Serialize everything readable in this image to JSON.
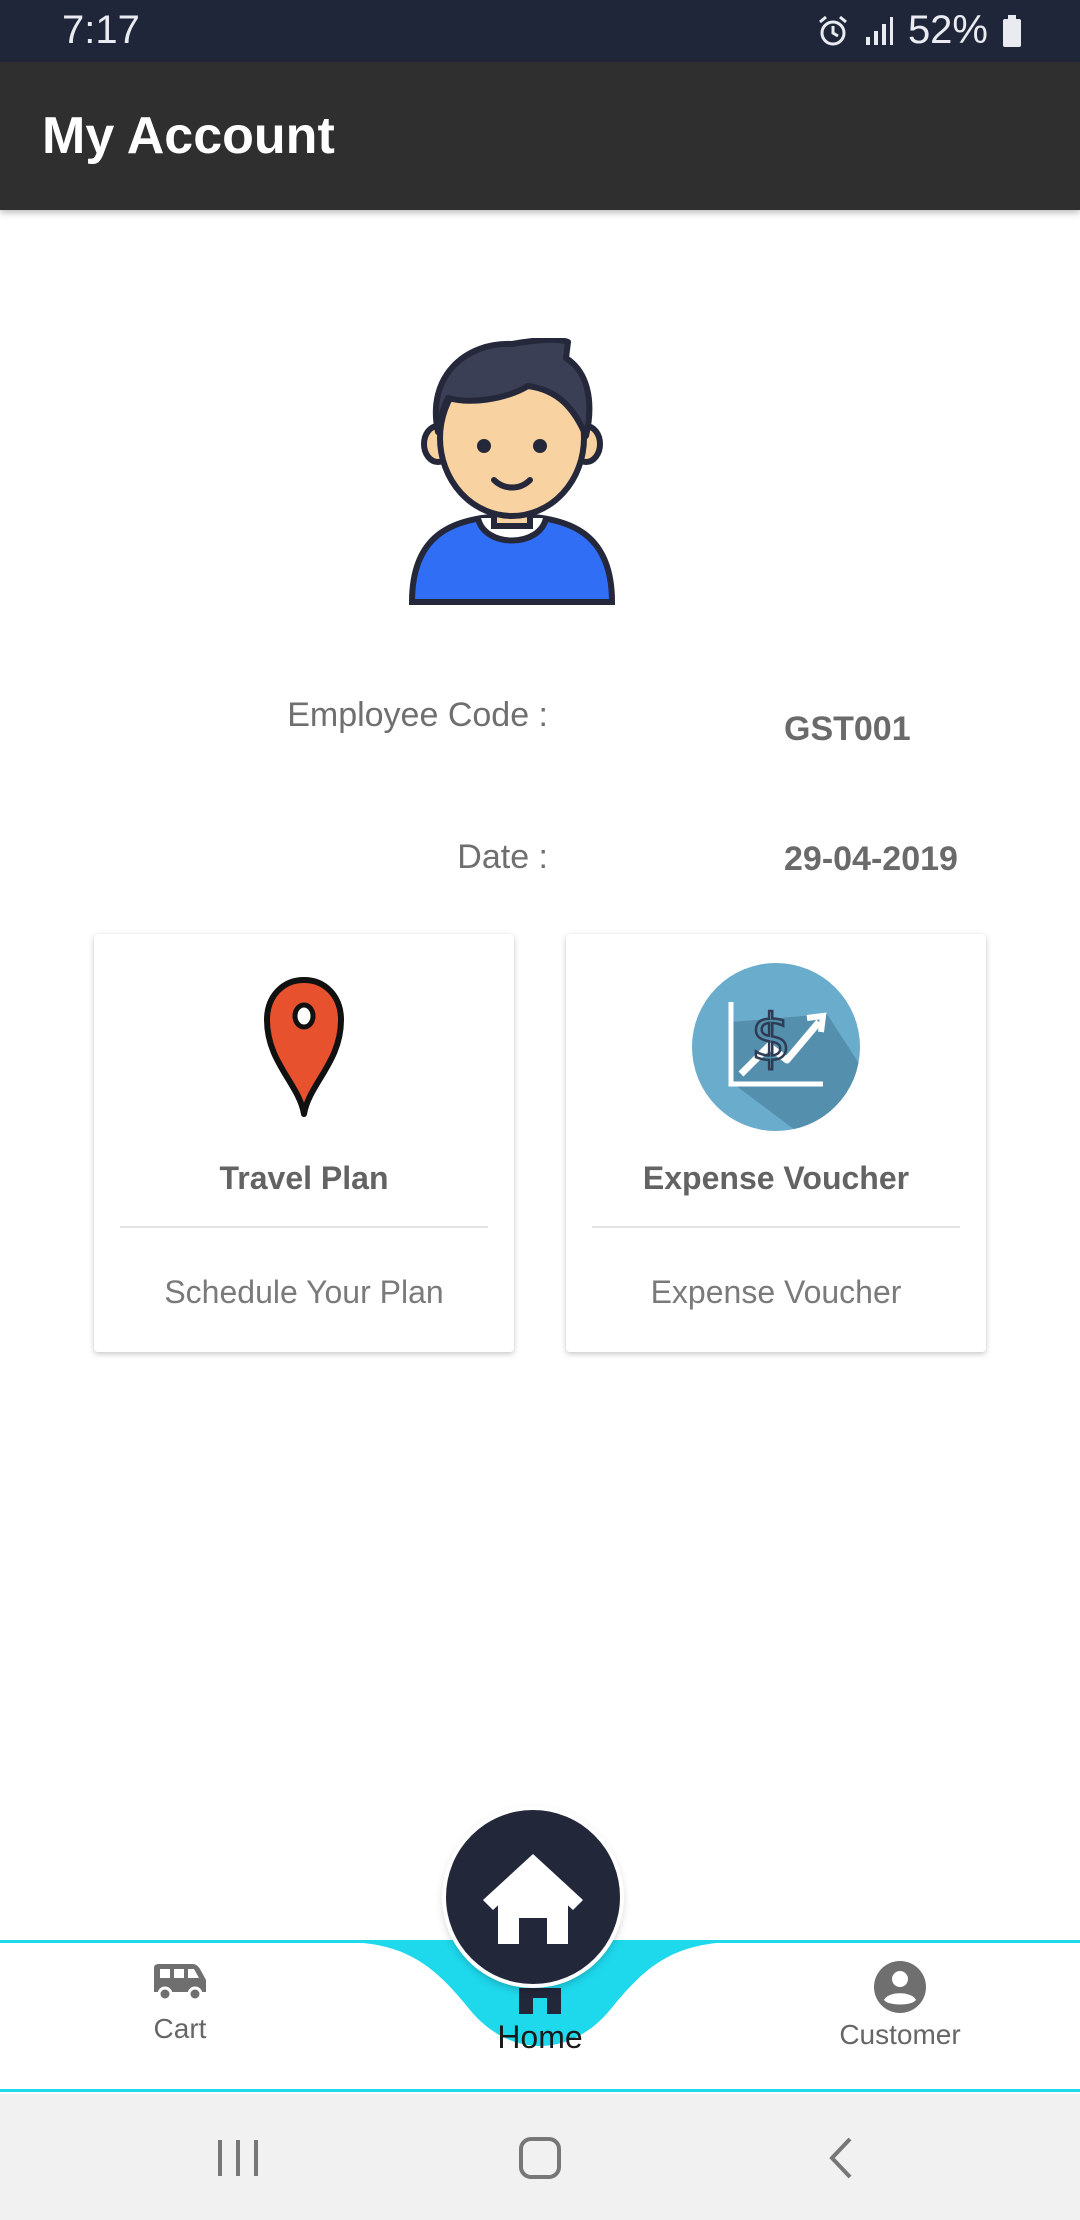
{
  "status_bar": {
    "time": "7:17",
    "battery": "52%"
  },
  "app_bar": {
    "title": "My Account"
  },
  "profile": {
    "employee_code_label": "Employee Code :",
    "employee_code_value": "GST001",
    "date_label": "Date :",
    "date_value": "29-04-2019"
  },
  "cards": [
    {
      "title": "Travel Plan",
      "subtitle": "Schedule Your Plan",
      "icon": "map-pin-icon"
    },
    {
      "title": "Expense Voucher",
      "subtitle": "Expense Voucher",
      "icon": "dollar-chart-icon"
    }
  ],
  "bottom_nav": {
    "items": [
      {
        "label": "Cart",
        "icon": "van-icon"
      },
      {
        "label": "Home",
        "icon": "home-icon"
      },
      {
        "label": "Customer",
        "icon": "account-circle-icon"
      }
    ]
  },
  "colors": {
    "status_bar": "#1f2639",
    "app_bar": "#2f2f2f",
    "accent_cyan": "#1ed8ec",
    "fab": "#22273a",
    "pin_red": "#e8512e",
    "chart_circle": "#6aaccc"
  }
}
